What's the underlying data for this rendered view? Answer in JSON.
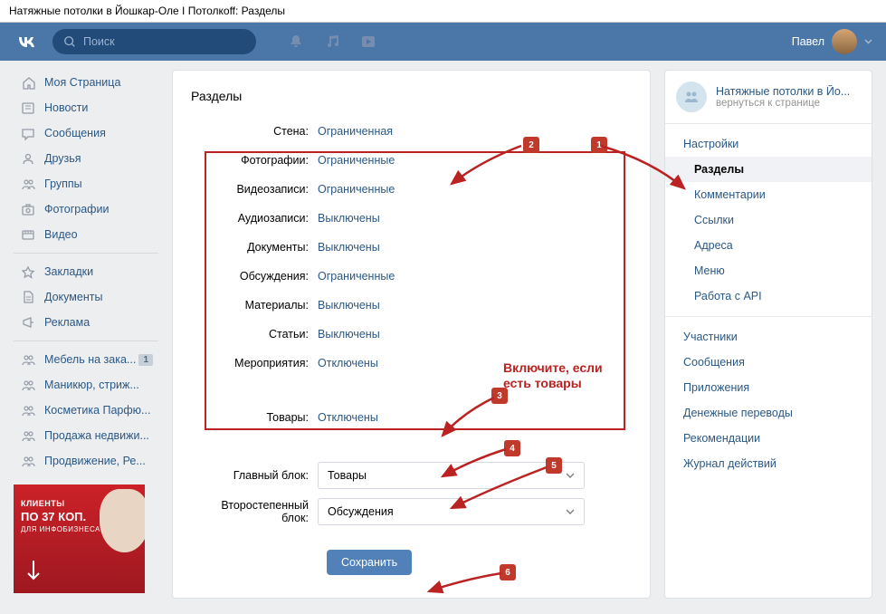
{
  "browser": {
    "title": "Натяжные потолки в Йошкар-Оле I Потолкоff: Разделы"
  },
  "header": {
    "search_placeholder": "Поиск",
    "user_name": "Павел"
  },
  "left_nav": {
    "main": [
      {
        "icon": "home",
        "label": "Моя Страница"
      },
      {
        "icon": "news",
        "label": "Новости"
      },
      {
        "icon": "messages",
        "label": "Сообщения"
      },
      {
        "icon": "friends",
        "label": "Друзья"
      },
      {
        "icon": "groups",
        "label": "Группы"
      },
      {
        "icon": "photos",
        "label": "Фотографии"
      },
      {
        "icon": "video",
        "label": "Видео"
      }
    ],
    "secondary": [
      {
        "icon": "bookmarks",
        "label": "Закладки"
      },
      {
        "icon": "docs",
        "label": "Документы"
      },
      {
        "icon": "ads",
        "label": "Реклама"
      }
    ],
    "groups": [
      {
        "icon": "group",
        "label": "Мебель на зака...",
        "badge": "1"
      },
      {
        "icon": "group",
        "label": "Маникюр, стриж..."
      },
      {
        "icon": "group",
        "label": "Косметика Парфю..."
      },
      {
        "icon": "group",
        "label": "Продажа недвижи..."
      },
      {
        "icon": "group",
        "label": "Продвижение, Ре..."
      }
    ]
  },
  "ad": {
    "line1": "КЛИЕНТЫ",
    "line2": "ПО 37 КОП.",
    "line3": "ДЛЯ ИНФОБИЗНЕСА"
  },
  "main_panel": {
    "title": "Разделы",
    "settings": [
      {
        "label": "Стена:",
        "value": "Ограниченная"
      },
      {
        "label": "Фотографии:",
        "value": "Ограниченные"
      },
      {
        "label": "Видеозаписи:",
        "value": "Ограниченные"
      },
      {
        "label": "Аудиозаписи:",
        "value": "Выключены"
      },
      {
        "label": "Документы:",
        "value": "Выключены"
      },
      {
        "label": "Обсуждения:",
        "value": "Ограниченные"
      },
      {
        "label": "Материалы:",
        "value": "Выключены"
      },
      {
        "label": "Статьи:",
        "value": "Выключены"
      },
      {
        "label": "Мероприятия:",
        "value": "Отключены"
      }
    ],
    "goods": {
      "label": "Товары:",
      "value": "Отключены"
    },
    "main_block": {
      "label": "Главный блок:",
      "value": "Товары"
    },
    "secondary_block": {
      "label": "Второстепенный блок:",
      "value": "Обсуждения"
    },
    "save_btn": "Сохранить"
  },
  "right_panel": {
    "group_name": "Натяжные потолки в Йо...",
    "back_link": "вернуться к странице",
    "menu": {
      "top": [
        {
          "label": "Настройки",
          "sub": false,
          "active": false
        },
        {
          "label": "Разделы",
          "sub": true,
          "active": true
        },
        {
          "label": "Комментарии",
          "sub": true,
          "active": false
        },
        {
          "label": "Ссылки",
          "sub": true,
          "active": false
        },
        {
          "label": "Адреса",
          "sub": true,
          "active": false
        },
        {
          "label": "Меню",
          "sub": true,
          "active": false
        },
        {
          "label": "Работа с API",
          "sub": true,
          "active": false
        }
      ],
      "bottom": [
        {
          "label": "Участники"
        },
        {
          "label": "Сообщения"
        },
        {
          "label": "Приложения"
        },
        {
          "label": "Денежные переводы"
        },
        {
          "label": "Рекомендации"
        },
        {
          "label": "Журнал действий"
        }
      ]
    }
  },
  "annotations": {
    "hint": "Включите, если\nесть товары",
    "badges": [
      "1",
      "2",
      "3",
      "4",
      "5",
      "6"
    ]
  }
}
